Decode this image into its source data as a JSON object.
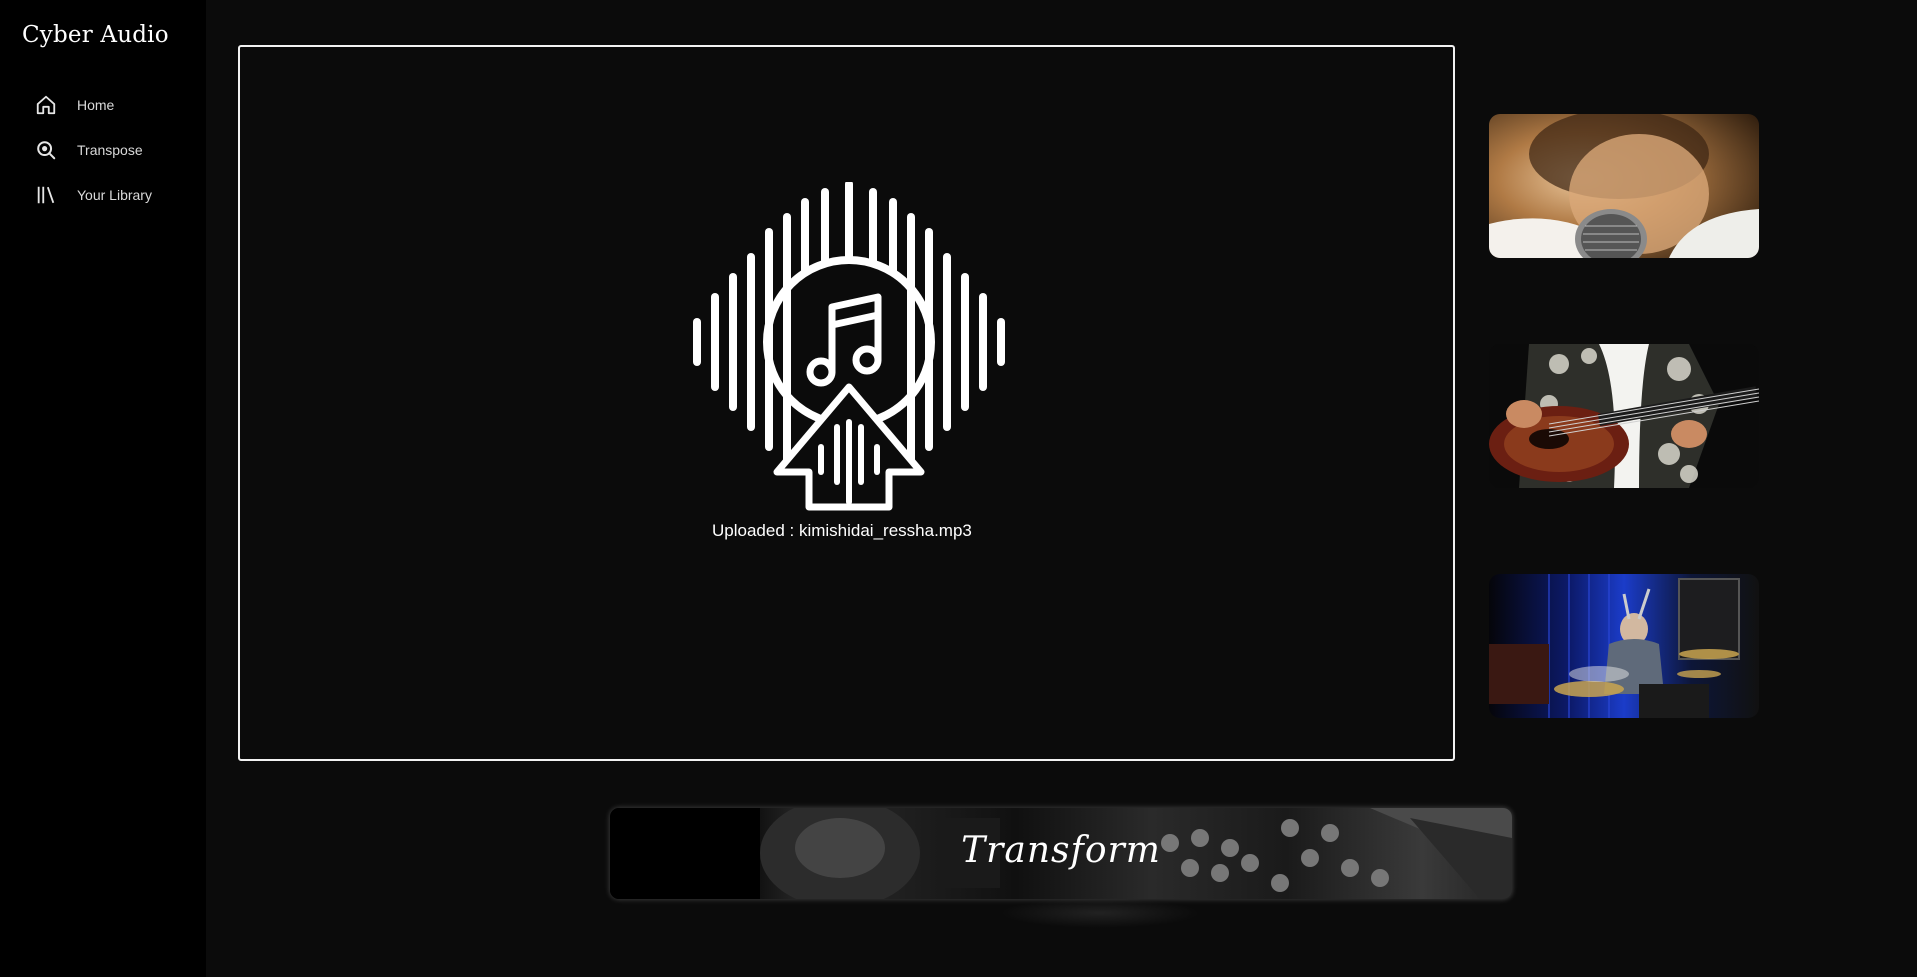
{
  "app": {
    "title": "Cyber Audio"
  },
  "sidebar": {
    "items": [
      {
        "label": "Home",
        "icon": "home-icon"
      },
      {
        "label": "Transpose",
        "icon": "search-icon"
      },
      {
        "label": "Your Library",
        "icon": "library-icon"
      }
    ]
  },
  "upload": {
    "status_text": "Uploaded : kimishidai_ressha.mp3",
    "icon": "music-upload-icon"
  },
  "gallery": {
    "images": [
      {
        "subject": "singer-with-microphone"
      },
      {
        "subject": "guitarist-playing-guitar"
      },
      {
        "subject": "drummer-playing-drums"
      }
    ]
  },
  "transform": {
    "label": "Transform"
  },
  "colors": {
    "background": "#0b0b0b",
    "sidebar": "#000000",
    "accent": "#ffffff"
  }
}
